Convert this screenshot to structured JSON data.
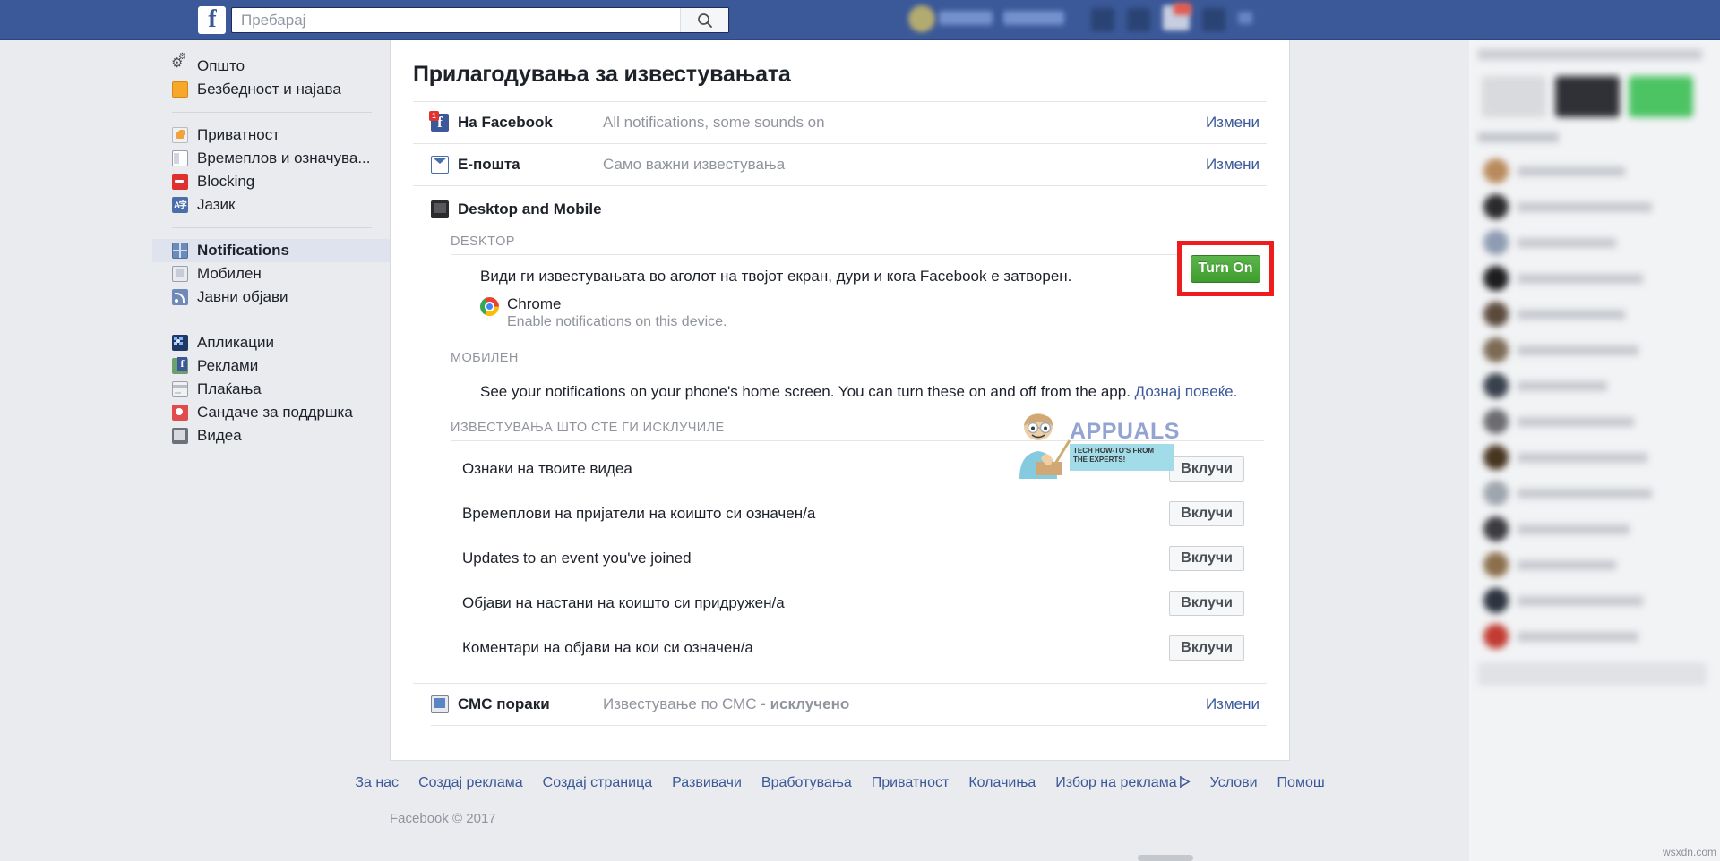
{
  "topbar": {
    "logo": "f",
    "search": {
      "placeholder": "Пребарај",
      "value": "",
      "icon": "search-icon"
    },
    "nav_icons": [
      "friend-requests-icon",
      "messages-icon",
      "notifications-icon",
      "account-menu-icon"
    ]
  },
  "sidebar": {
    "groups": [
      {
        "items": [
          {
            "label": "Општо",
            "icon": "gears-icon",
            "active": false
          },
          {
            "label": "Безбедност и најава",
            "icon": "shield-icon",
            "active": false
          }
        ]
      },
      {
        "items": [
          {
            "label": "Приватност",
            "icon": "lock-icon",
            "active": false
          },
          {
            "label": "Времеплов и означува...",
            "icon": "timeline-icon",
            "active": false
          },
          {
            "label": "Blocking",
            "icon": "block-icon",
            "active": false
          },
          {
            "label": "Јазик",
            "icon": "language-icon",
            "active": false
          }
        ]
      },
      {
        "items": [
          {
            "label": "Notifications",
            "icon": "globe-icon",
            "active": true
          },
          {
            "label": "Мобилен",
            "icon": "phone-icon",
            "active": false
          },
          {
            "label": "Јавни објави",
            "icon": "rss-icon",
            "active": false
          }
        ]
      },
      {
        "items": [
          {
            "label": "Апликации",
            "icon": "apps-icon",
            "active": false
          },
          {
            "label": "Реклами",
            "icon": "ads-icon",
            "active": false
          },
          {
            "label": "Плаќања",
            "icon": "payments-icon",
            "active": false
          },
          {
            "label": "Сандаче за поддршка",
            "icon": "support-icon",
            "active": false
          },
          {
            "label": "Видеа",
            "icon": "video-icon",
            "active": false
          }
        ]
      }
    ]
  },
  "main": {
    "title": "Прилагодувања за известувањата",
    "rows": [
      {
        "label": "На Facebook",
        "status": "All notifications, some sounds on",
        "edit": "Измени",
        "icon": "facebook-icon",
        "badge": "1"
      },
      {
        "label": "Е-пошта",
        "status": "Само важни известувања",
        "edit": "Измени",
        "icon": "mail-icon"
      }
    ],
    "desktop_mobile": {
      "heading": "Desktop and Mobile",
      "icon": "device-icon",
      "desktop_label": "DESKTOP",
      "desktop_description": "Види ги известувањата во аголот на твојот екран, дури и кога Facebook е затворен.",
      "browser_name": "Chrome",
      "browser_sub": "Enable notifications on this device.",
      "browser_icon": "chrome-icon",
      "turn_on_label": "Turn On",
      "highlight_color": "#ee1c1c",
      "button_color": "#4a9f36",
      "mobile_label": "МОБИЛЕН",
      "mobile_description": "See your notifications on your phone's home screen. You can turn these on and off from the app.",
      "mobile_link": "Дознај повеќе."
    },
    "turned_off": {
      "heading": "ИЗВЕСТУВАЊА ШТО СТЕ ГИ ИСКЛУЧИЛЕ",
      "button_label": "Вклучи",
      "items": [
        "Ознаки на твоите видеа",
        "Времеплови на пријатели на коишто си означен/а",
        "Updates to an event you've joined",
        "Објави на настани на коишто си придружен/а",
        "Коментари на објави на кои си означен/а"
      ]
    },
    "sms_row": {
      "label": "СМС пораки",
      "status_prefix": "Известување по СМС - ",
      "status_strong": "исклучено",
      "edit": "Измени",
      "icon": "sms-icon"
    }
  },
  "watermark": {
    "title": "APPUALS",
    "subtitle": "TECH HOW-TO'S FROM THE EXPERTS!"
  },
  "footer": {
    "links": [
      "За нас",
      "Создај реклама",
      "Создај страница",
      "Развивачи",
      "Вработувања",
      "Приватност",
      "Колачиња",
      "Избор на реклама",
      "Услови",
      "Помош"
    ],
    "ad_choice_index": 7,
    "copyright": "Facebook © 2017"
  },
  "right_column": {
    "attribution": "wsxdn.com"
  }
}
